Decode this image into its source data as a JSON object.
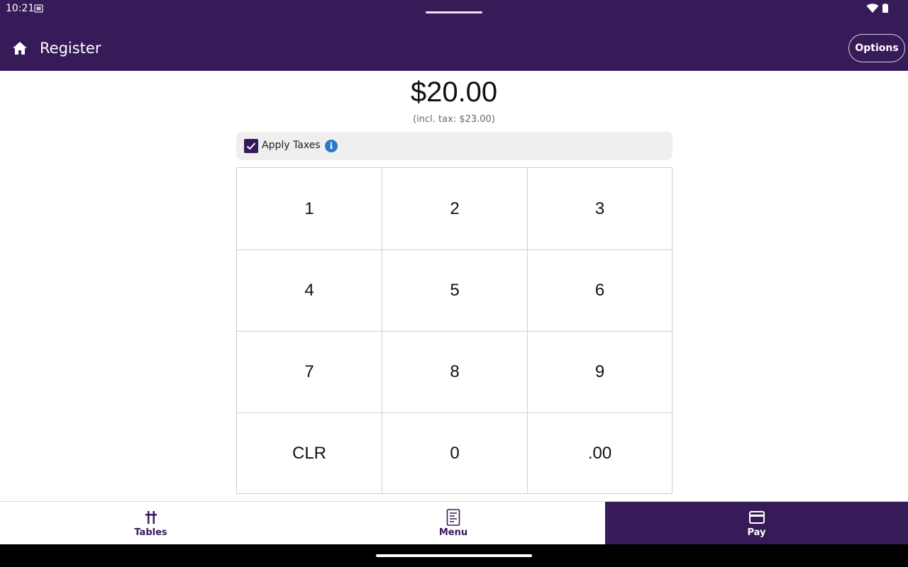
{
  "status_bar": {
    "time": "10:21",
    "icons": [
      "screenshot-icon",
      "wifi-icon",
      "battery-icon"
    ]
  },
  "app_bar": {
    "title": "Register",
    "options_label": "Options",
    "home_icon": "home-icon"
  },
  "amount": {
    "value": "$20.00",
    "incl_tax": "(incl. tax: $23.00)"
  },
  "taxes": {
    "label": "Apply Taxes",
    "checked": true,
    "info_glyph": "i"
  },
  "keypad": {
    "keys": [
      "1",
      "2",
      "3",
      "4",
      "5",
      "6",
      "7",
      "8",
      "9",
      "CLR",
      "0",
      ".00"
    ]
  },
  "bottom_nav": {
    "items": [
      {
        "label": "Tables",
        "icon": "tables-icon",
        "selected": false
      },
      {
        "label": "Menu",
        "icon": "menu-icon",
        "selected": false
      },
      {
        "label": "Pay",
        "icon": "credit-card-icon",
        "selected": true
      }
    ]
  },
  "colors": {
    "primary": "#371b58",
    "info": "#2a7ac9",
    "surface": "#efefef"
  }
}
